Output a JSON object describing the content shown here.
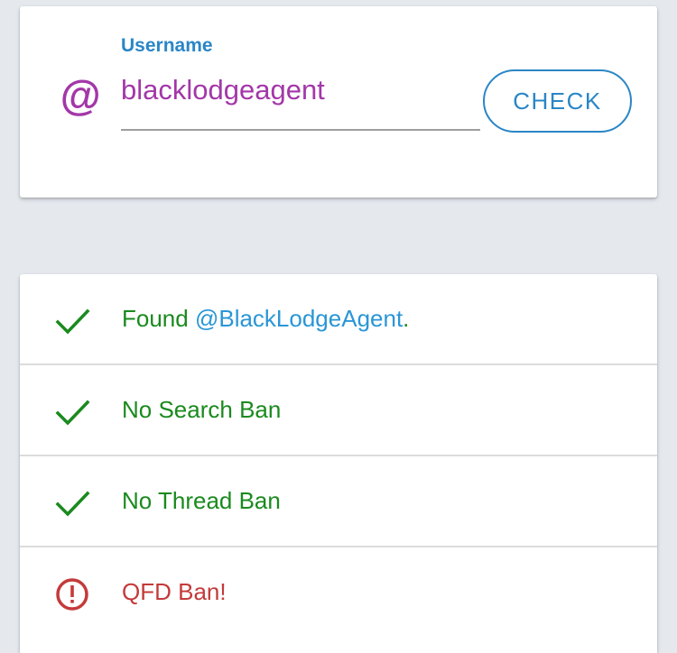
{
  "search": {
    "label": "Username",
    "at_symbol": "@",
    "input_value": "blacklodgeagent",
    "button_label": "CHECK",
    "icon": "at-icon"
  },
  "results": {
    "found": {
      "prefix": "Found ",
      "handle": "@BlackLodgeAgent",
      "suffix": ".",
      "status": "ok",
      "icon": "check-icon"
    },
    "search_ban": {
      "text": "No Search Ban",
      "status": "ok",
      "icon": "check-icon"
    },
    "thread_ban": {
      "text": "No Thread Ban",
      "status": "ok",
      "icon": "check-icon"
    },
    "qfd_ban": {
      "text": "QFD Ban!",
      "status": "error",
      "icon": "alert-icon"
    }
  },
  "colors": {
    "ok": "#1a8a1e",
    "error": "#c43a3a",
    "accent": "#2a86c6",
    "input": "#a337a8"
  }
}
